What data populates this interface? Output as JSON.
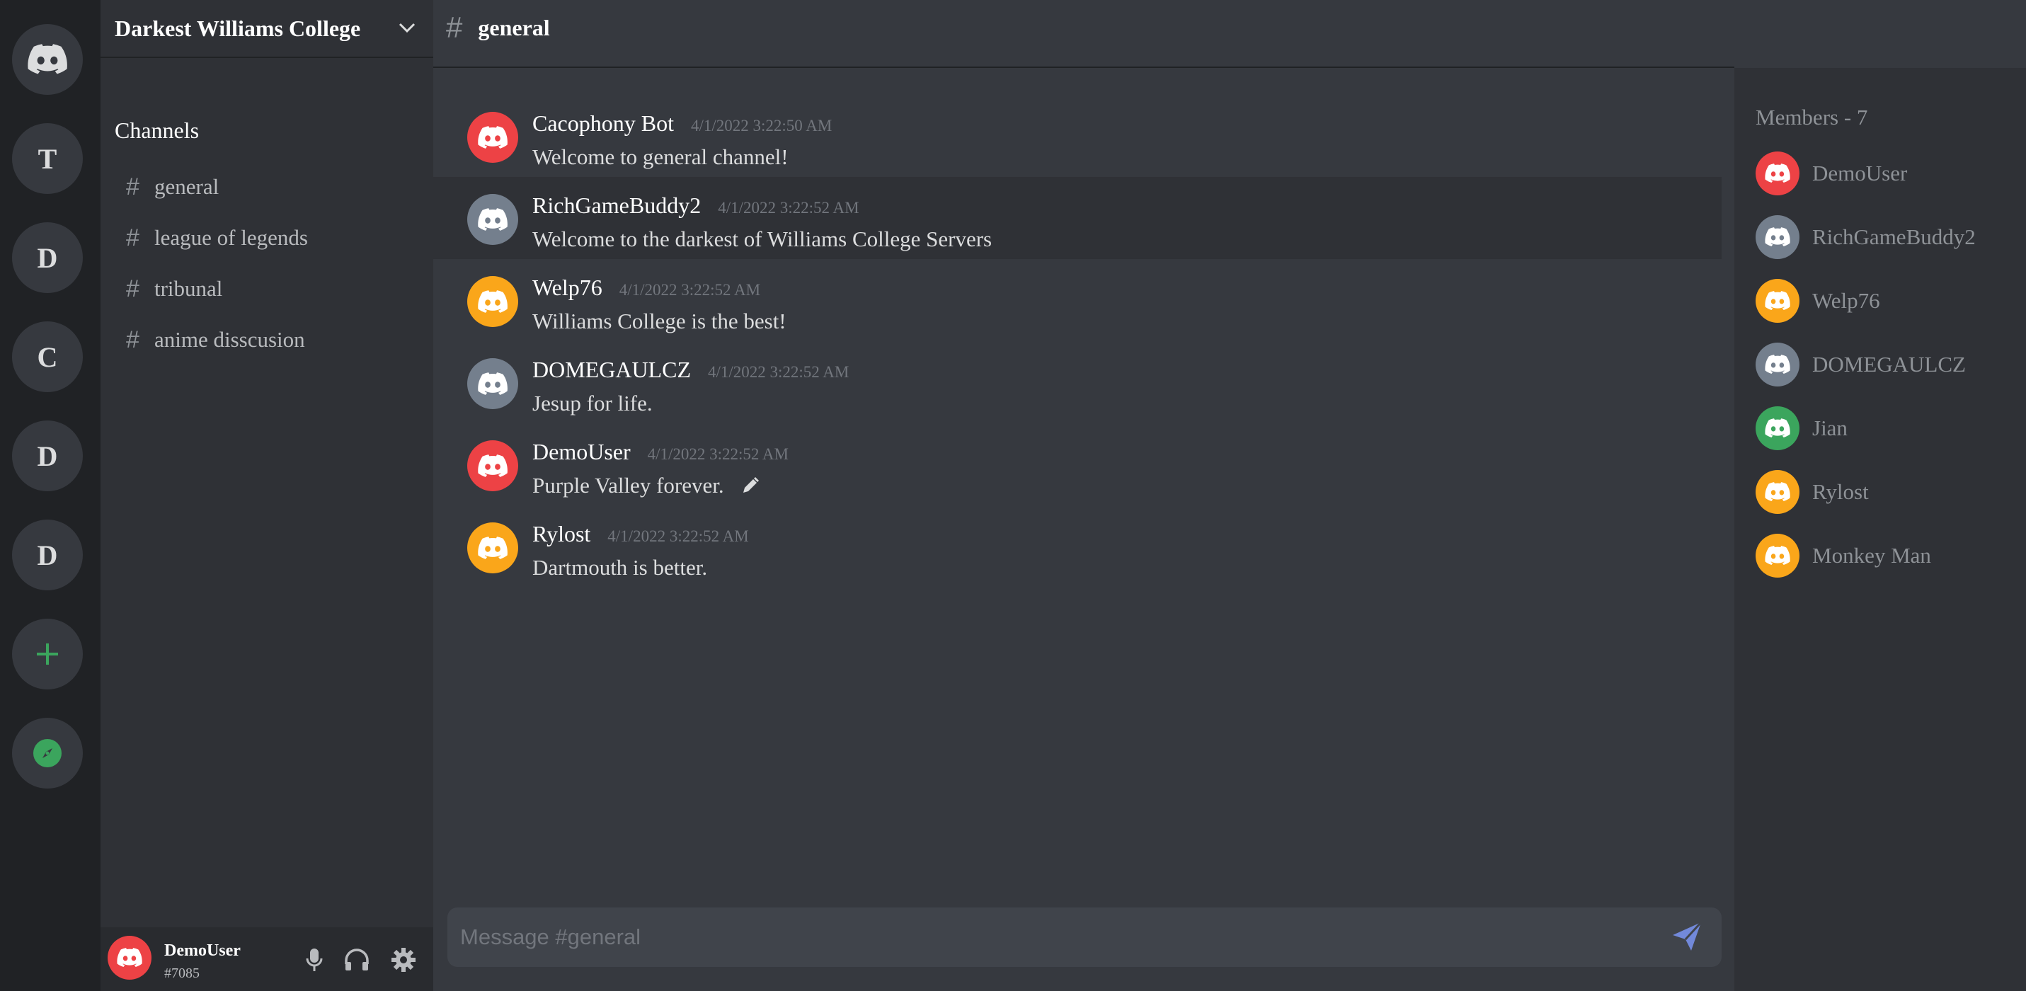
{
  "colors": {
    "red": "#ed4245",
    "grey": "#747f8d",
    "yellow": "#faa61a",
    "green": "#3ba55d",
    "accent": "#7289da"
  },
  "rail": {
    "servers": [
      {
        "letter": "T"
      },
      {
        "letter": "D"
      },
      {
        "letter": "C"
      },
      {
        "letter": "D"
      },
      {
        "letter": "D"
      }
    ]
  },
  "sidebar": {
    "server_name": "Darkest Williams College",
    "channels_title": "Channels",
    "channels": [
      {
        "hash": "#",
        "label": "general"
      },
      {
        "hash": "#",
        "label": "league of legends"
      },
      {
        "hash": "#",
        "label": "tribunal"
      },
      {
        "hash": "#",
        "label": "anime disscusion"
      }
    ]
  },
  "user_panel": {
    "name": "DemoUser",
    "tag": "#7085"
  },
  "header": {
    "hash": "#",
    "channel": "general"
  },
  "messages": [
    {
      "author": "Cacophony Bot",
      "time": "4/1/2022 3:22:50 AM",
      "text": "Welcome to general channel!",
      "avatar_color": "red"
    },
    {
      "author": "RichGameBuddy2",
      "time": "4/1/2022 3:22:52 AM",
      "text": "Welcome to the darkest of Williams College Servers",
      "avatar_color": "grey"
    },
    {
      "author": "Welp76",
      "time": "4/1/2022 3:22:52 AM",
      "text": "Williams College is the best!",
      "avatar_color": "yellow"
    },
    {
      "author": "DOMEGAULCZ",
      "time": "4/1/2022 3:22:52 AM",
      "text": "Jesup for life.",
      "avatar_color": "grey"
    },
    {
      "author": "DemoUser",
      "time": "4/1/2022 3:22:52 AM",
      "text": "Purple Valley forever.",
      "avatar_color": "red"
    },
    {
      "author": "Rylost",
      "time": "4/1/2022 3:22:52 AM",
      "text": "Dartmouth is better.",
      "avatar_color": "yellow"
    }
  ],
  "composer": {
    "placeholder": "Message #general"
  },
  "members": {
    "title": "Members - 7",
    "list": [
      {
        "name": "DemoUser",
        "avatar_color": "red"
      },
      {
        "name": "RichGameBuddy2",
        "avatar_color": "grey"
      },
      {
        "name": "Welp76",
        "avatar_color": "yellow"
      },
      {
        "name": "DOMEGAULCZ",
        "avatar_color": "grey"
      },
      {
        "name": "Jian",
        "avatar_color": "green"
      },
      {
        "name": "Rylost",
        "avatar_color": "yellow"
      },
      {
        "name": "Monkey Man",
        "avatar_color": "yellow"
      }
    ]
  }
}
